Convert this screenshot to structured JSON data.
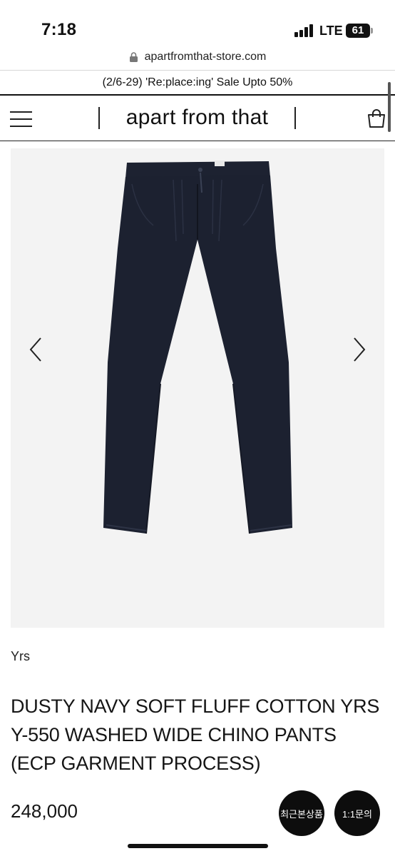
{
  "status_bar": {
    "time": "7:18",
    "network": "LTE",
    "battery": "61"
  },
  "browser": {
    "url": "apartfromthat-store.com",
    "lock_icon": "lock-icon"
  },
  "promo": {
    "text": "(2/6-29) 'Re:place:ing' Sale Upto 50%"
  },
  "header": {
    "brand": "apart from that",
    "menu_icon": "hamburger-menu-icon",
    "cart_icon": "shopping-bag-icon"
  },
  "gallery": {
    "prev_icon": "chevron-left-icon",
    "next_icon": "chevron-right-icon",
    "image": "navy-wide-chino-pants-photo",
    "background": "#f3f3f3",
    "product_color": "#1c2130"
  },
  "product": {
    "brand": "Yrs",
    "title": "DUSTY NAVY SOFT FLUFF COTTON YRS Y-550 WASHED WIDE CHINO PANTS (ECP GARMENT PROCESS)",
    "price": "248,000"
  },
  "floating": {
    "recent_label": "최근본상품",
    "chat_label": "1:1문의"
  }
}
